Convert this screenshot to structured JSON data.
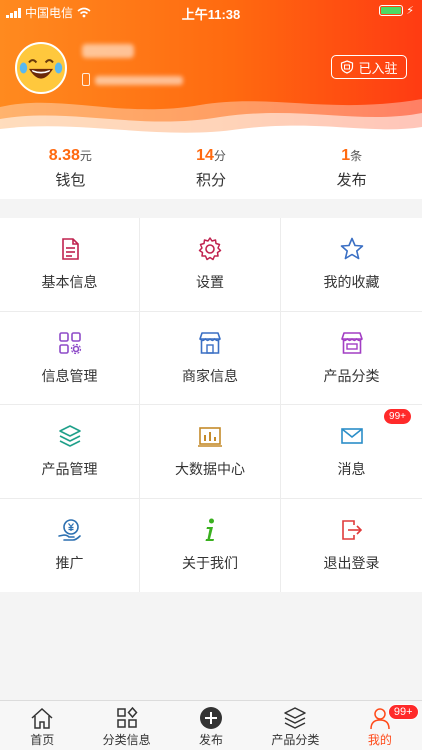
{
  "status": {
    "carrier": "中国电信",
    "time": "上午11:38"
  },
  "profile": {
    "joined_label": "已入驻"
  },
  "stats": [
    {
      "value": "8.38",
      "unit": "元",
      "label": "钱包"
    },
    {
      "value": "14",
      "unit": "分",
      "label": "积分"
    },
    {
      "value": "1",
      "unit": "条",
      "label": "发布"
    }
  ],
  "menu": [
    {
      "label": "基本信息",
      "icon": "document-icon",
      "color": "#c0224f"
    },
    {
      "label": "设置",
      "icon": "gear-icon",
      "color": "#c0224f"
    },
    {
      "label": "我的收藏",
      "icon": "star-icon",
      "color": "#3a6fc4"
    },
    {
      "label": "信息管理",
      "icon": "grid-gear-icon",
      "color": "#8e4bc8"
    },
    {
      "label": "商家信息",
      "icon": "store-icon",
      "color": "#3a6fc4"
    },
    {
      "label": "产品分类",
      "icon": "store-icon",
      "color": "#a23ec4"
    },
    {
      "label": "产品管理",
      "icon": "layers-icon",
      "color": "#1fa08a"
    },
    {
      "label": "大数据中心",
      "icon": "bar-chart-icon",
      "color": "#c48a2a"
    },
    {
      "label": "消息",
      "icon": "mail-icon",
      "color": "#2b8ec8",
      "badge": "99+"
    },
    {
      "label": "推广",
      "icon": "yuan-hand-icon",
      "color": "#2b6fb0"
    },
    {
      "label": "关于我们",
      "icon": "info-icon",
      "color": "#3ab01f"
    },
    {
      "label": "退出登录",
      "icon": "logout-icon",
      "color": "#e03a3a"
    }
  ],
  "tabs": [
    {
      "label": "首页",
      "icon": "home-icon"
    },
    {
      "label": "分类信息",
      "icon": "grid-icon"
    },
    {
      "label": "发布",
      "icon": "plus-circle-icon"
    },
    {
      "label": "产品分类",
      "icon": "layers-icon"
    },
    {
      "label": "我的",
      "icon": "user-icon",
      "badge": "99+",
      "active": true
    }
  ],
  "colors": {
    "accent": "#ff6a10",
    "badge": "#ff2a2a",
    "active_tab": "#ff4a1a"
  }
}
